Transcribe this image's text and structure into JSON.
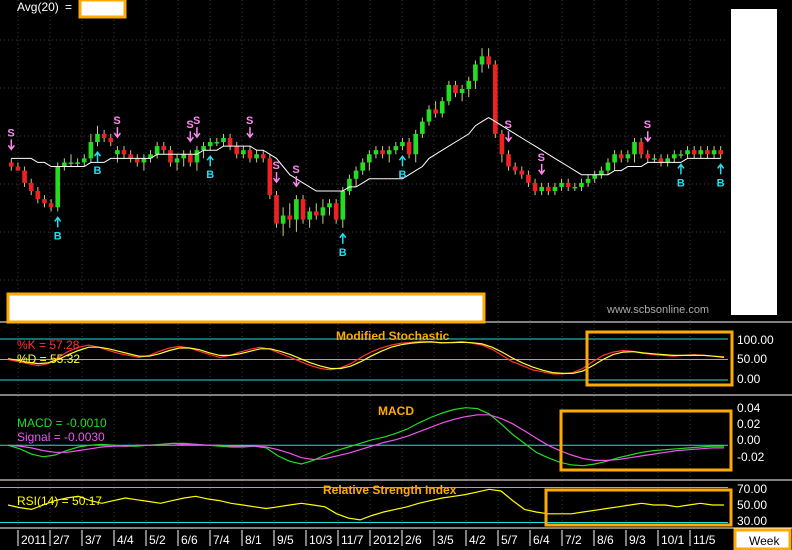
{
  "colors": {
    "background": "#000000",
    "grid": "#3a3a3a",
    "up": "#22dd22",
    "down": "#ee2222",
    "avg_line": "#ffffff",
    "sell": "#ff88ee",
    "buy": "#22ddee",
    "highlight": "#ffaa00",
    "k_line": "#ff3333",
    "d_line": "#ffff33",
    "macd_line": "#22dd22",
    "signal_line": "#ee55ee",
    "rsi_line": "#ffff00",
    "ref_line": "#22dddd",
    "title": "#ffaa00"
  },
  "price_panel": {
    "avg_label": "Avg(20)",
    "avg_eq": "=",
    "watermark": "www.scbsonline.com",
    "signal_sell_letter": "S",
    "signal_buy_letter": "B"
  },
  "x_axis": {
    "labels": [
      "2011",
      "2/7",
      "3/7",
      "4/4",
      "5/2",
      "6/6",
      "7/4",
      "8/1",
      "9/5",
      "10/3",
      "11/7",
      "2012",
      "2/6",
      "3/5",
      "4/2",
      "5/7",
      "6/4",
      "7/2",
      "8/6",
      "9/3",
      "10/1",
      "11/5"
    ],
    "period_button": "Week"
  },
  "chart_data": [
    {
      "type": "candlestick",
      "panel": "price",
      "series": [
        {
          "name": "Avg(20)",
          "style": "line"
        }
      ],
      "candles_ohlc": [
        [
          0.52,
          0.5,
          0.53,
          0.51
        ],
        [
          0.51,
          0.5,
          0.52,
          0.5
        ],
        [
          0.5,
          0.46,
          0.51,
          0.47
        ],
        [
          0.47,
          0.44,
          0.48,
          0.45
        ],
        [
          0.45,
          0.42,
          0.46,
          0.43
        ],
        [
          0.43,
          0.41,
          0.44,
          0.42
        ],
        [
          0.42,
          0.4,
          0.43,
          0.41
        ],
        [
          0.41,
          0.4,
          0.52,
          0.51
        ],
        [
          0.51,
          0.5,
          0.53,
          0.52
        ],
        [
          0.52,
          0.51,
          0.54,
          0.52
        ],
        [
          0.52,
          0.51,
          0.53,
          0.52
        ],
        [
          0.52,
          0.51,
          0.54,
          0.53
        ],
        [
          0.53,
          0.52,
          0.59,
          0.57
        ],
        [
          0.57,
          0.56,
          0.61,
          0.59
        ],
        [
          0.59,
          0.57,
          0.6,
          0.58
        ],
        [
          0.58,
          0.56,
          0.59,
          0.57
        ],
        [
          0.54,
          0.52,
          0.56,
          0.55
        ],
        [
          0.55,
          0.53,
          0.56,
          0.54
        ],
        [
          0.54,
          0.52,
          0.55,
          0.53
        ],
        [
          0.53,
          0.51,
          0.54,
          0.52
        ],
        [
          0.52,
          0.5,
          0.54,
          0.53
        ],
        [
          0.53,
          0.52,
          0.55,
          0.54
        ],
        [
          0.54,
          0.53,
          0.57,
          0.56
        ],
        [
          0.56,
          0.54,
          0.57,
          0.55
        ],
        [
          0.55,
          0.51,
          0.56,
          0.52
        ],
        [
          0.52,
          0.5,
          0.54,
          0.53
        ],
        [
          0.53,
          0.51,
          0.55,
          0.54
        ],
        [
          0.54,
          0.51,
          0.55,
          0.52
        ],
        [
          0.52,
          0.5,
          0.56,
          0.55
        ],
        [
          0.55,
          0.53,
          0.57,
          0.56
        ],
        [
          0.56,
          0.55,
          0.58,
          0.57
        ],
        [
          0.57,
          0.56,
          0.58,
          0.57
        ],
        [
          0.57,
          0.56,
          0.59,
          0.58
        ],
        [
          0.58,
          0.55,
          0.59,
          0.56
        ],
        [
          0.56,
          0.53,
          0.57,
          0.54
        ],
        [
          0.54,
          0.53,
          0.56,
          0.55
        ],
        [
          0.55,
          0.52,
          0.56,
          0.53
        ],
        [
          0.53,
          0.52,
          0.55,
          0.54
        ],
        [
          0.54,
          0.52,
          0.55,
          0.53
        ],
        [
          0.53,
          0.43,
          0.54,
          0.44
        ],
        [
          0.44,
          0.36,
          0.45,
          0.37
        ],
        [
          0.37,
          0.34,
          0.41,
          0.39
        ],
        [
          0.39,
          0.36,
          0.42,
          0.38
        ],
        [
          0.38,
          0.35,
          0.44,
          0.43
        ],
        [
          0.43,
          0.37,
          0.44,
          0.38
        ],
        [
          0.38,
          0.36,
          0.41,
          0.4
        ],
        [
          0.4,
          0.38,
          0.42,
          0.39
        ],
        [
          0.39,
          0.37,
          0.43,
          0.41
        ],
        [
          0.41,
          0.39,
          0.43,
          0.42
        ],
        [
          0.42,
          0.37,
          0.43,
          0.38
        ],
        [
          0.38,
          0.36,
          0.46,
          0.45
        ],
        [
          0.45,
          0.44,
          0.49,
          0.48
        ],
        [
          0.48,
          0.46,
          0.51,
          0.5
        ],
        [
          0.5,
          0.49,
          0.53,
          0.52
        ],
        [
          0.52,
          0.5,
          0.55,
          0.54
        ],
        [
          0.54,
          0.53,
          0.56,
          0.55
        ],
        [
          0.55,
          0.53,
          0.56,
          0.54
        ],
        [
          0.54,
          0.52,
          0.56,
          0.55
        ],
        [
          0.55,
          0.54,
          0.57,
          0.56
        ],
        [
          0.56,
          0.55,
          0.58,
          0.57
        ],
        [
          0.57,
          0.53,
          0.58,
          0.54
        ],
        [
          0.54,
          0.52,
          0.6,
          0.59
        ],
        [
          0.59,
          0.58,
          0.63,
          0.62
        ],
        [
          0.62,
          0.61,
          0.66,
          0.65
        ],
        [
          0.65,
          0.63,
          0.67,
          0.64
        ],
        [
          0.64,
          0.63,
          0.68,
          0.67
        ],
        [
          0.67,
          0.66,
          0.72,
          0.71
        ],
        [
          0.71,
          0.68,
          0.72,
          0.69
        ],
        [
          0.69,
          0.67,
          0.71,
          0.7
        ],
        [
          0.7,
          0.68,
          0.73,
          0.72
        ],
        [
          0.72,
          0.7,
          0.77,
          0.76
        ],
        [
          0.76,
          0.74,
          0.8,
          0.78
        ],
        [
          0.78,
          0.75,
          0.8,
          0.76
        ],
        [
          0.76,
          0.58,
          0.77,
          0.59
        ],
        [
          0.59,
          0.52,
          0.6,
          0.54
        ],
        [
          0.54,
          0.5,
          0.55,
          0.51
        ],
        [
          0.51,
          0.49,
          0.52,
          0.5
        ],
        [
          0.5,
          0.48,
          0.51,
          0.49
        ],
        [
          0.49,
          0.46,
          0.5,
          0.47
        ],
        [
          0.47,
          0.44,
          0.48,
          0.45
        ],
        [
          0.45,
          0.44,
          0.47,
          0.46
        ],
        [
          0.46,
          0.44,
          0.47,
          0.45
        ],
        [
          0.45,
          0.44,
          0.47,
          0.46
        ],
        [
          0.46,
          0.45,
          0.48,
          0.47
        ],
        [
          0.47,
          0.45,
          0.48,
          0.46
        ],
        [
          0.46,
          0.45,
          0.47,
          0.46
        ],
        [
          0.46,
          0.45,
          0.48,
          0.47
        ],
        [
          0.47,
          0.46,
          0.49,
          0.48
        ],
        [
          0.48,
          0.47,
          0.5,
          0.49
        ],
        [
          0.49,
          0.48,
          0.51,
          0.5
        ],
        [
          0.5,
          0.49,
          0.53,
          0.52
        ],
        [
          0.52,
          0.5,
          0.55,
          0.54
        ],
        [
          0.54,
          0.52,
          0.55,
          0.53
        ],
        [
          0.53,
          0.52,
          0.55,
          0.54
        ],
        [
          0.54,
          0.52,
          0.58,
          0.57
        ],
        [
          0.57,
          0.53,
          0.58,
          0.54
        ],
        [
          0.54,
          0.52,
          0.55,
          0.53
        ],
        [
          0.53,
          0.52,
          0.54,
          0.53
        ],
        [
          0.53,
          0.51,
          0.54,
          0.52
        ],
        [
          0.52,
          0.51,
          0.54,
          0.53
        ],
        [
          0.53,
          0.52,
          0.55,
          0.54
        ],
        [
          0.54,
          0.53,
          0.55,
          0.54
        ],
        [
          0.54,
          0.53,
          0.56,
          0.55
        ],
        [
          0.55,
          0.53,
          0.56,
          0.54
        ],
        [
          0.54,
          0.53,
          0.56,
          0.55
        ],
        [
          0.55,
          0.53,
          0.56,
          0.54
        ],
        [
          0.54,
          0.53,
          0.56,
          0.55
        ],
        [
          0.55,
          0.53,
          0.56,
          0.54
        ]
      ],
      "avg20": [
        0.53,
        0.53,
        0.53,
        0.53,
        0.52,
        0.52,
        0.51,
        0.51,
        0.51,
        0.51,
        0.51,
        0.51,
        0.52,
        0.52,
        0.52,
        0.53,
        0.53,
        0.53,
        0.53,
        0.53,
        0.53,
        0.53,
        0.54,
        0.54,
        0.54,
        0.54,
        0.54,
        0.54,
        0.54,
        0.55,
        0.55,
        0.55,
        0.56,
        0.56,
        0.56,
        0.56,
        0.56,
        0.55,
        0.55,
        0.54,
        0.53,
        0.51,
        0.49,
        0.48,
        0.47,
        0.46,
        0.45,
        0.45,
        0.45,
        0.45,
        0.45,
        0.46,
        0.46,
        0.47,
        0.48,
        0.48,
        0.48,
        0.48,
        0.48,
        0.48,
        0.49,
        0.5,
        0.51,
        0.53,
        0.54,
        0.55,
        0.56,
        0.57,
        0.58,
        0.59,
        0.61,
        0.62,
        0.63,
        0.62,
        0.61,
        0.6,
        0.59,
        0.58,
        0.57,
        0.56,
        0.55,
        0.54,
        0.53,
        0.52,
        0.51,
        0.5,
        0.49,
        0.49,
        0.49,
        0.49,
        0.49,
        0.5,
        0.5,
        0.51,
        0.51,
        0.51,
        0.52,
        0.52,
        0.52,
        0.52,
        0.52,
        0.52,
        0.53,
        0.53,
        0.53,
        0.53,
        0.53,
        0.53
      ],
      "signals": [
        {
          "type": "S",
          "index": 0
        },
        {
          "type": "B",
          "index": 7
        },
        {
          "type": "B",
          "index": 13
        },
        {
          "type": "S",
          "index": 16
        },
        {
          "type": "S",
          "index": 27
        },
        {
          "type": "S",
          "index": 28
        },
        {
          "type": "B",
          "index": 30
        },
        {
          "type": "S",
          "index": 36
        },
        {
          "type": "S",
          "index": 40
        },
        {
          "type": "S",
          "index": 43
        },
        {
          "type": "B",
          "index": 50
        },
        {
          "type": "B",
          "index": 59
        },
        {
          "type": "S",
          "index": 75
        },
        {
          "type": "S",
          "index": 80
        },
        {
          "type": "S",
          "index": 96
        },
        {
          "type": "B",
          "index": 101
        },
        {
          "type": "B",
          "index": 107
        }
      ]
    },
    {
      "type": "line",
      "panel": "stochastic",
      "title": "Modified Stochastic",
      "y_ticks": [
        "100.00",
        "50.00",
        "0.00"
      ],
      "series": [
        {
          "name": "%K",
          "label": "%K  =  57.28",
          "values": [
            50,
            45,
            40,
            35,
            40,
            55,
            70,
            80,
            85,
            80,
            72,
            65,
            60,
            55,
            60,
            70,
            78,
            82,
            78,
            70,
            62,
            55,
            60,
            68,
            75,
            80,
            75,
            65,
            55,
            45,
            35,
            28,
            25,
            30,
            40,
            55,
            68,
            78,
            85,
            90,
            92,
            95,
            93,
            90,
            92,
            94,
            90,
            85,
            75,
            60,
            45,
            35,
            25,
            20,
            15,
            15,
            18,
            28,
            45,
            60,
            68,
            72,
            70,
            65,
            62,
            60,
            58,
            60,
            62,
            60,
            58,
            57
          ]
        },
        {
          "name": "%D",
          "label": "%D  =  55.32",
          "values": [
            52,
            48,
            43,
            40,
            42,
            50,
            62,
            72,
            80,
            80,
            76,
            70,
            64,
            58,
            58,
            64,
            72,
            78,
            78,
            74,
            66,
            60,
            60,
            64,
            70,
            76,
            76,
            70,
            62,
            52,
            42,
            34,
            28,
            28,
            34,
            45,
            58,
            70,
            80,
            86,
            90,
            92,
            93,
            91,
            91,
            92,
            91,
            88,
            80,
            68,
            54,
            42,
            32,
            24,
            18,
            16,
            16,
            22,
            35,
            50,
            62,
            68,
            69,
            66,
            64,
            62,
            60,
            60,
            60,
            60,
            58,
            55
          ]
        }
      ]
    },
    {
      "type": "line",
      "panel": "macd",
      "title": "MACD",
      "y_ticks": [
        "0.04",
        "0.02",
        "0.00",
        "-0.02"
      ],
      "series": [
        {
          "name": "MACD",
          "label": "MACD  =  -0.0010",
          "values": [
            0.0,
            -0.004,
            -0.01,
            -0.013,
            -0.011,
            -0.006,
            -0.002,
            0.0,
            0.001,
            0.0,
            -0.001,
            -0.001,
            0.0,
            0.001,
            0.002,
            0.002,
            0.001,
            0.0,
            -0.001,
            -0.002,
            -0.002,
            -0.001,
            -0.003,
            -0.012,
            -0.018,
            -0.021,
            -0.017,
            -0.011,
            -0.006,
            -0.002,
            0.002,
            0.006,
            0.009,
            0.013,
            0.018,
            0.025,
            0.031,
            0.036,
            0.04,
            0.042,
            0.041,
            0.035,
            0.024,
            0.012,
            0.002,
            -0.008,
            -0.014,
            -0.019,
            -0.022,
            -0.023,
            -0.021,
            -0.018,
            -0.014,
            -0.011,
            -0.008,
            -0.006,
            -0.005,
            -0.004,
            -0.003,
            -0.002,
            -0.001,
            -0.001
          ]
        },
        {
          "name": "Signal",
          "label": "Signal  =  -0.0030",
          "values": [
            0.0,
            -0.001,
            -0.003,
            -0.006,
            -0.008,
            -0.008,
            -0.006,
            -0.004,
            -0.002,
            -0.001,
            -0.001,
            0.0,
            0.0,
            0.0,
            0.0,
            0.001,
            0.001,
            0.0,
            0.0,
            -0.001,
            -0.001,
            -0.001,
            -0.002,
            -0.005,
            -0.009,
            -0.014,
            -0.016,
            -0.015,
            -0.012,
            -0.009,
            -0.005,
            -0.001,
            0.003,
            0.006,
            0.01,
            0.015,
            0.02,
            0.025,
            0.029,
            0.032,
            0.034,
            0.034,
            0.03,
            0.024,
            0.016,
            0.008,
            0.0,
            -0.006,
            -0.011,
            -0.015,
            -0.017,
            -0.017,
            -0.016,
            -0.014,
            -0.012,
            -0.01,
            -0.008,
            -0.006,
            -0.005,
            -0.004,
            -0.003,
            -0.003
          ]
        }
      ]
    },
    {
      "type": "line",
      "panel": "rsi",
      "title": "Relative Strength Index",
      "y_ticks": [
        "70.00",
        "50.00",
        "30.00"
      ],
      "series": [
        {
          "name": "RSI(14)",
          "label": "RSI(14)  =  50.17",
          "values": [
            50,
            47,
            45,
            50,
            55,
            58,
            60,
            55,
            52,
            55,
            58,
            56,
            54,
            52,
            55,
            58,
            60,
            57,
            55,
            52,
            50,
            48,
            46,
            48,
            50,
            52,
            50,
            48,
            40,
            35,
            33,
            38,
            42,
            45,
            48,
            52,
            55,
            58,
            60,
            62,
            65,
            68,
            66,
            55,
            45,
            42,
            40,
            40,
            40,
            42,
            44,
            46,
            48,
            50,
            52,
            50,
            50,
            48,
            50,
            52,
            50,
            50
          ]
        }
      ]
    }
  ]
}
